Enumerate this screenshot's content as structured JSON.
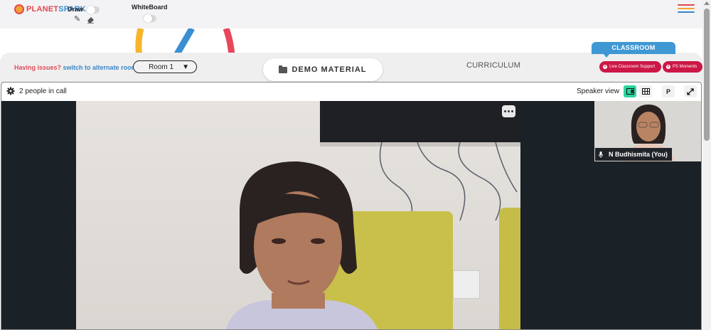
{
  "app": {
    "logo_text_1": "PLANET",
    "logo_text_2": "SPARK"
  },
  "toolbar": {
    "draw_label": "Draw",
    "whiteboard_label": "WhiteBoard",
    "icons": [
      "pencil-icon",
      "eraser-icon",
      "hamburger-menu-icon"
    ]
  },
  "roombar": {
    "issues_text": "Having issues?",
    "switch_link": "switch to alternate room",
    "room_selected": "Room 1",
    "demo_material_label": "DEMO MATERIAL",
    "curriculum_label": "CURRICULUM",
    "classroom_tab": "CLASSROOM",
    "live_support_label": "Live Classroom Support",
    "ps_moments_label": "PS Moments"
  },
  "call": {
    "people_count": "2 people in call",
    "view_label": "Speaker view",
    "presenter_btn": "P",
    "self_name": "N Budhismita (You)"
  },
  "colors": {
    "brand_red": "#e5474d",
    "brand_blue": "#3b86c7",
    "accent_pink": "#cc1846",
    "active_teal": "#2dd4a0",
    "classroom_blue": "#3f98d4"
  }
}
